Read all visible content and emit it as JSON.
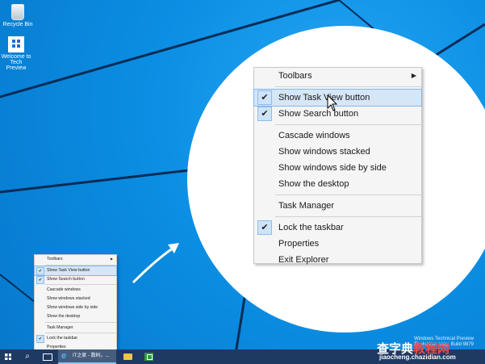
{
  "desktop_icons": [
    {
      "label": "Recycle Bin",
      "icon": "recycle-bin-icon"
    },
    {
      "label": "Welcome to\nTech Preview",
      "icon": "windows-logo-icon"
    }
  ],
  "context_menu": {
    "items": [
      {
        "label": "Toolbars",
        "checked": false,
        "submenu": true
      },
      {
        "separator": true
      },
      {
        "label": "Show Task View button",
        "checked": true,
        "highlighted": true
      },
      {
        "label": "Show Search button",
        "checked": true
      },
      {
        "separator": true
      },
      {
        "label": "Cascade windows",
        "checked": false
      },
      {
        "label": "Show windows stacked",
        "checked": false
      },
      {
        "label": "Show windows side by side",
        "checked": false
      },
      {
        "label": "Show the desktop",
        "checked": false
      },
      {
        "separator": true
      },
      {
        "label": "Task Manager",
        "checked": false
      },
      {
        "separator": true
      },
      {
        "label": "Lock the taskbar",
        "checked": true
      },
      {
        "label": "Properties",
        "checked": false
      },
      {
        "label": "Exit Explorer",
        "checked": false
      }
    ],
    "check_glyph": "✔",
    "submenu_glyph": "▶"
  },
  "taskbar": {
    "ie_window_title": "IT之家 - 数码，...",
    "icons": [
      "windows-start-icon",
      "search-icon",
      "task-view-icon",
      "internet-explorer-icon",
      "file-explorer-icon",
      "store-icon"
    ]
  },
  "watermark": {
    "tech_preview_line1": "Windows Technical Preview",
    "tech_preview_line2": "Evaluation copy. Build 9879",
    "site_name_part1": "查字典",
    "site_name_part2": "教程网",
    "site_url": "jiaocheng.chazidian.com"
  },
  "colors": {
    "desktop_blue": "#0b8ee3",
    "menu_highlight": "#d5e6f7",
    "check_box": "#cde3f9",
    "taskbar": "#1e3a63"
  }
}
